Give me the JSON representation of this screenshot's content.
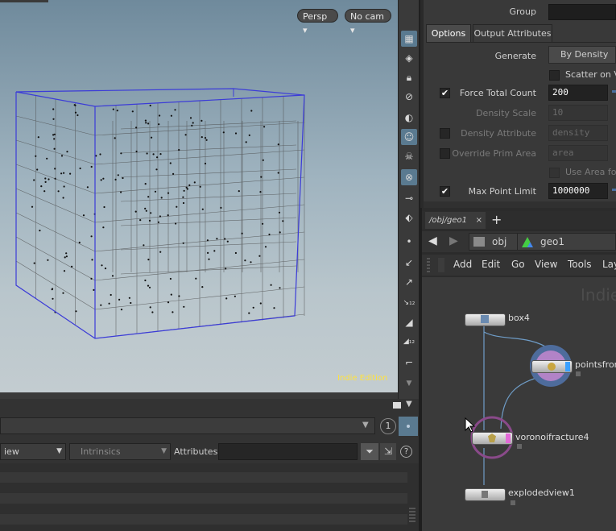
{
  "viewport": {
    "persp_label": "Persp ▾",
    "cam_label": "No cam ▾",
    "watermark": "Indie Edition"
  },
  "lower_left": {
    "view_label": "iew",
    "intrinsics_label": "Intrinsics",
    "attributes_label": "Attributes:",
    "badge": "1"
  },
  "params": {
    "group_label": "Group",
    "tabs": [
      "Options",
      "Output Attributes"
    ],
    "generate_label": "Generate",
    "generate_value": "By Density",
    "scatter_label": "Scatter on Vo",
    "force_total_label": "Force Total Count",
    "force_total_value": "200",
    "density_scale_label": "Density Scale",
    "density_scale_value": "10",
    "density_attr_label": "Density Attribute",
    "density_attr_value": "density",
    "override_prim_label": "Override Prim Area",
    "override_prim_value": "area",
    "use_area_label": "Use Area for",
    "max_point_label": "Max Point Limit",
    "max_point_value": "1000000"
  },
  "network": {
    "tab_label": "/obj/geo1",
    "path": [
      "obj",
      "geo1"
    ],
    "menu": [
      "Add",
      "Edit",
      "Go",
      "View",
      "Tools",
      "Lay"
    ],
    "watermark": "Indie",
    "nodes": [
      "box4",
      "pointsfrom",
      "voronoifracture4",
      "explodedview1"
    ]
  },
  "colors": {
    "accent_blue": "#4a6fa0",
    "watermark_yellow": "#ffe23d",
    "bbox_blue": "#3b3bd8"
  }
}
